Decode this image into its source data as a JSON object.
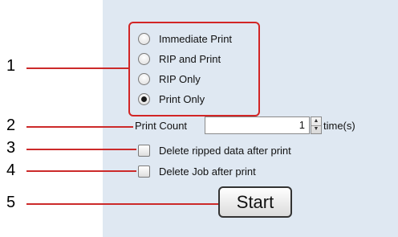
{
  "callouts": [
    "1",
    "2",
    "3",
    "4",
    "5"
  ],
  "print_mode": {
    "options": [
      {
        "label": "Immediate Print",
        "checked": false
      },
      {
        "label": "RIP and Print",
        "checked": false
      },
      {
        "label": "RIP Only",
        "checked": false
      },
      {
        "label": "Print Only",
        "checked": true
      }
    ]
  },
  "print_count": {
    "label": "Print Count",
    "value": "1",
    "unit": "time(s)"
  },
  "delete_ripped": {
    "label": "Delete ripped data after print",
    "checked": false
  },
  "delete_job": {
    "label": "Delete Job after print",
    "checked": false
  },
  "start_button": {
    "label": "Start"
  },
  "colors": {
    "highlight": "#d22525",
    "callout_line": "#cc2a2a",
    "panel_bg": "#dfe8f2"
  }
}
